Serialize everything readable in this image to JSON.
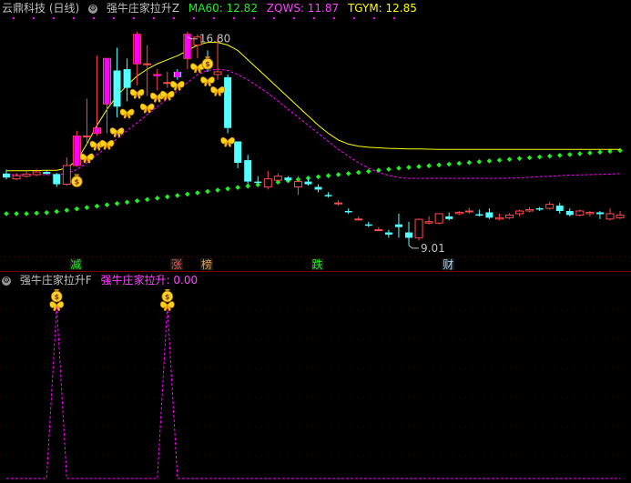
{
  "main_header": {
    "stock": "云鼎科技 (日线)",
    "indicator": "强牛庄家拉升Z",
    "ma60": "MA60: 12.82",
    "zqws": "ZQWS: 11.87",
    "tgym": "TGYM: 12.85"
  },
  "sub_header": {
    "indicator": "强牛庄家拉升F",
    "value": "强牛庄家拉升: 0.00"
  },
  "colors": {
    "up": "#ff4a4a",
    "down": "#54ffff",
    "yellow_line": "#ffff00",
    "pink_line": "#ff00ff",
    "green_dots": "#22ee22",
    "magenta_bars": "#ff00ff",
    "header_pink": "#ff44ff",
    "header_yellow": "#ffff00",
    "header_green": "#22ee22"
  },
  "chart_data": [
    {
      "type": "candlestick",
      "series": [
        {
          "name": "candles",
          "ohlc": [
            [
              11.7,
              11.55,
              11.85,
              11.48
            ],
            [
              11.5,
              11.62,
              11.72,
              11.45
            ],
            [
              11.6,
              11.68,
              11.78,
              11.55
            ],
            [
              11.66,
              11.76,
              11.86,
              11.6
            ],
            [
              11.76,
              11.69,
              11.82,
              11.65
            ],
            [
              11.68,
              11.3,
              11.72,
              11.2
            ],
            [
              11.3,
              12.0,
              12.3,
              11.25
            ],
            [
              12.0,
              13.1,
              13.3,
              11.95
            ],
            [
              13.1,
              13.1,
              14.5,
              12.8
            ],
            [
              13.2,
              13.4,
              16.1,
              13.1
            ],
            [
              14.3,
              16.0,
              16.0,
              13.2
            ],
            [
              15.55,
              14.2,
              16.4,
              13.8
            ],
            [
              15.6,
              14.9,
              16.0,
              14.4
            ],
            [
              15.8,
              16.9,
              17.0,
              15.0
            ],
            [
              15.8,
              15.8,
              16.5,
              14.6
            ],
            [
              15.4,
              15.4,
              15.6,
              14.8
            ],
            [
              15.1,
              15.1,
              15.5,
              14.9
            ],
            [
              15.5,
              15.3,
              15.6,
              15.2
            ],
            [
              16.0,
              16.9,
              17.0,
              15.6
            ],
            [
              16.5,
              16.8,
              16.9,
              16.0
            ],
            [
              15.9,
              15.7,
              16.3,
              15.5
            ],
            [
              15.4,
              15.5,
              16.8,
              15.2
            ],
            [
              15.3,
              13.4,
              15.4,
              13.2
            ],
            [
              12.9,
              12.1,
              12.9,
              11.9
            ],
            [
              12.2,
              11.4,
              12.4,
              11.3
            ],
            [
              11.4,
              11.35,
              11.6,
              11.3
            ],
            [
              11.2,
              11.5,
              11.8,
              11.1
            ],
            [
              11.45,
              11.6,
              11.7,
              11.4
            ],
            [
              11.55,
              11.45,
              11.6,
              11.4
            ],
            [
              11.2,
              11.4,
              11.6,
              10.9
            ],
            [
              11.4,
              11.3,
              11.5,
              11.25
            ],
            [
              11.2,
              11.1,
              11.3,
              11.0
            ],
            [
              10.9,
              10.85,
              11.0,
              10.8
            ],
            [
              10.6,
              10.6,
              10.7,
              10.5
            ],
            [
              10.3,
              10.25,
              10.4,
              10.2
            ],
            [
              10.0,
              10.0,
              10.1,
              9.95
            ],
            [
              9.8,
              9.75,
              9.9,
              9.7
            ],
            [
              9.6,
              9.6,
              9.7,
              9.55
            ],
            [
              9.5,
              9.42,
              9.6,
              9.3
            ],
            [
              9.8,
              9.7,
              10.2,
              9.3
            ],
            [
              9.5,
              9.3,
              9.9,
              9.01
            ],
            [
              9.3,
              9.99,
              10.02,
              9.2
            ],
            [
              9.85,
              9.9,
              10.1,
              9.8
            ],
            [
              9.85,
              10.2,
              10.2,
              9.8
            ],
            [
              10.1,
              10.0,
              10.25,
              9.95
            ],
            [
              10.2,
              10.25,
              10.3,
              10.15
            ],
            [
              10.28,
              10.3,
              10.42,
              10.2
            ],
            [
              10.18,
              10.13,
              10.35,
              10.1
            ],
            [
              10.25,
              10.05,
              10.4,
              10.0
            ],
            [
              10.0,
              10.05,
              10.2,
              9.95
            ],
            [
              10.05,
              10.15,
              10.22,
              10.0
            ],
            [
              10.2,
              10.3,
              10.35,
              10.1
            ],
            [
              10.3,
              10.35,
              10.45,
              10.25
            ],
            [
              10.4,
              10.35,
              10.45,
              10.3
            ],
            [
              10.4,
              10.55,
              10.65,
              10.35
            ],
            [
              10.5,
              10.3,
              10.6,
              10.2
            ],
            [
              10.3,
              10.15,
              10.4,
              10.1
            ],
            [
              10.15,
              10.3,
              10.35,
              10.1
            ],
            [
              10.2,
              10.25,
              10.3,
              10.1
            ],
            [
              10.25,
              10.18,
              10.3,
              10.0
            ],
            [
              10.0,
              10.2,
              10.4,
              9.95
            ],
            [
              10.05,
              10.15,
              10.3,
              10.0
            ]
          ]
        },
        {
          "name": "MA60",
          "values": [
            11.8,
            11.8,
            11.8,
            11.81,
            11.82,
            11.82,
            11.9,
            12.2,
            12.8,
            13.5,
            14.1,
            14.6,
            15.0,
            15.35,
            15.6,
            15.8,
            15.95,
            16.1,
            16.3,
            16.5,
            16.6,
            16.6,
            16.5,
            16.3,
            15.95,
            15.6,
            15.25,
            14.9,
            14.55,
            14.2,
            13.85,
            13.5,
            13.2,
            12.95,
            12.8,
            12.72,
            12.68,
            12.66,
            12.64,
            12.63,
            12.62,
            12.62,
            12.61,
            12.6,
            12.6,
            12.6,
            12.6,
            12.6,
            12.6,
            12.6,
            12.6,
            12.6,
            12.6,
            12.6,
            12.6,
            12.6,
            12.6,
            12.6,
            12.6,
            12.6,
            12.6,
            12.6
          ]
        },
        {
          "name": "ZQWS",
          "values": [
            11.66,
            11.66,
            11.66,
            11.66,
            11.66,
            11.66,
            11.7,
            11.85,
            12.1,
            12.4,
            12.7,
            13.0,
            13.3,
            13.6,
            13.9,
            14.2,
            14.5,
            14.8,
            15.1,
            15.4,
            15.55,
            15.6,
            15.55,
            15.4,
            15.2,
            14.95,
            14.7,
            14.4,
            14.1,
            13.8,
            13.5,
            13.2,
            12.9,
            12.6,
            12.35,
            12.1,
            11.9,
            11.74,
            11.63,
            11.55,
            11.52,
            11.52,
            11.52,
            11.52,
            11.52,
            11.52,
            11.52,
            11.52,
            11.52,
            11.52,
            11.53,
            11.54,
            11.56,
            11.58,
            11.6,
            11.62,
            11.64,
            11.65,
            11.66,
            11.67,
            11.68,
            11.7
          ]
        },
        {
          "name": "TGYM",
          "values": [
            10.2,
            10.2,
            10.2,
            10.22,
            10.24,
            10.28,
            10.33,
            10.38,
            10.43,
            10.48,
            10.53,
            10.58,
            10.63,
            10.68,
            10.73,
            10.78,
            10.83,
            10.88,
            10.93,
            10.98,
            11.03,
            11.08,
            11.13,
            11.18,
            11.23,
            11.28,
            11.33,
            11.38,
            11.43,
            11.48,
            11.53,
            11.58,
            11.62,
            11.66,
            11.7,
            11.74,
            11.78,
            11.82,
            11.86,
            11.9,
            11.93,
            11.96,
            11.99,
            12.02,
            12.05,
            12.08,
            12.11,
            12.14,
            12.17,
            12.2,
            12.23,
            12.26,
            12.29,
            12.32,
            12.35,
            12.38,
            12.41,
            12.44,
            12.47,
            12.5,
            12.53,
            12.56
          ]
        }
      ],
      "annotations": [
        {
          "text": "16.80",
          "index": 18,
          "y": 16.8
        },
        {
          "text": "9.01",
          "index": 40,
          "y": 9.01
        }
      ],
      "event_labels": [
        {
          "text": "减",
          "index": 7,
          "color": "#22ee22"
        },
        {
          "text": "涨",
          "index": 17,
          "color": "#ff4a4a"
        },
        {
          "text": "榜",
          "index": 20,
          "color": "#e8a040"
        },
        {
          "text": "跌",
          "index": 31,
          "color": "#22ee22"
        },
        {
          "text": "财",
          "index": 44,
          "color": "#9fd8ff"
        }
      ]
    },
    {
      "type": "line",
      "series": [
        {
          "name": "强牛庄家拉升",
          "values": [
            0,
            0,
            0,
            0,
            0,
            1,
            0,
            0,
            0,
            0,
            0,
            0,
            0,
            0,
            0,
            0,
            1,
            0,
            0,
            0,
            0,
            0,
            0,
            0,
            0,
            0,
            0,
            0,
            0,
            0,
            0,
            0,
            0,
            0,
            0,
            0,
            0,
            0,
            0,
            0,
            0,
            0,
            0,
            0,
            0,
            0,
            0,
            0,
            0,
            0,
            0,
            0,
            0,
            0,
            0,
            0,
            0,
            0,
            0,
            0,
            0,
            0
          ]
        }
      ],
      "ylim": [
        0,
        1
      ]
    }
  ]
}
